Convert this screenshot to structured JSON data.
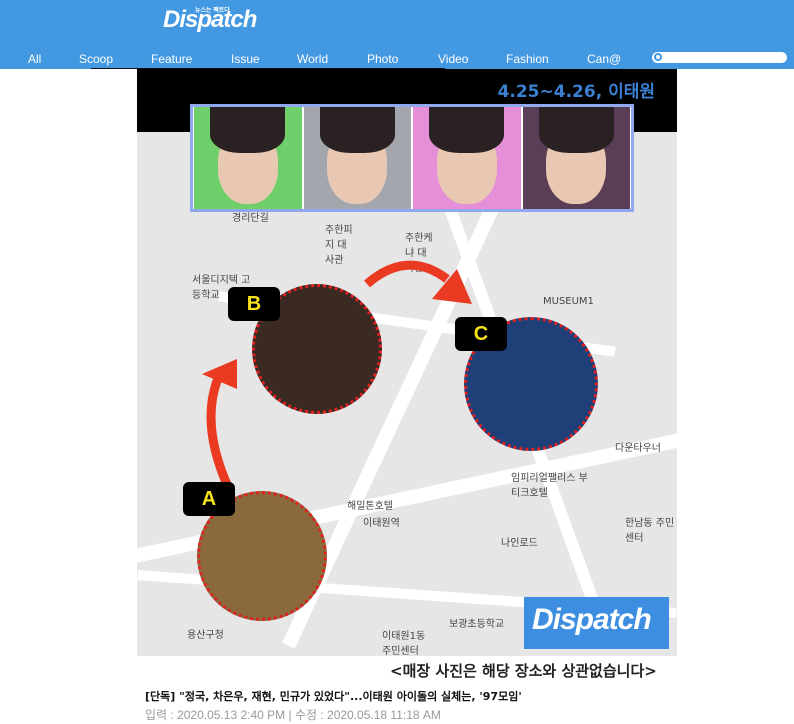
{
  "header": {
    "logo": "Dispatch",
    "logo_tagline": "뉴스는 팩트다",
    "brand_color": "#4398e2",
    "nav": [
      {
        "label": "All"
      },
      {
        "label": "Scoop"
      },
      {
        "label": "Feature"
      },
      {
        "label": "Issue"
      },
      {
        "label": "World"
      },
      {
        "label": "Photo"
      },
      {
        "label": "Video"
      },
      {
        "label": "Fashion"
      },
      {
        "label": "Can@"
      }
    ],
    "search_icon": "search-icon"
  },
  "article_image": {
    "dates": "4.25~4.26, 이태원",
    "markers": [
      {
        "label": "A"
      },
      {
        "label": "B"
      },
      {
        "label": "C"
      }
    ],
    "map_labels": [
      "경리단길",
      "주한피지 대사관",
      "주한케냐 대사관",
      "서울디지텍 고등학교",
      "MUSEUM1",
      "다운타우너",
      "임피리얼팰리스 부티크호텔",
      "이태원역",
      "나인로드",
      "한남동 주민센터",
      "용산구청",
      "이태원1동 주민센터",
      "보광초등학교",
      "해밀톤호텔"
    ],
    "watermark": "Dispatch"
  },
  "caption": "<매장 사진은 해당 장소와 상관없습니다>",
  "article": {
    "title": "[단독] \"정국, 차은우, 재현, 민규가 있었다\"...이태원 아이돌의 실체는, '97모임'",
    "meta": "입력 : 2020.05.13 2:40 PM | 수정 : 2020.05.18 11:18 AM"
  }
}
